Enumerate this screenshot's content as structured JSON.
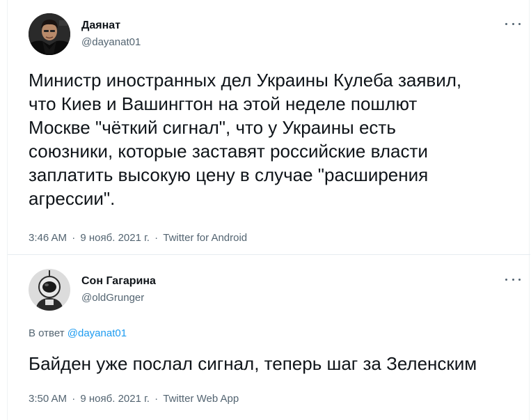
{
  "tweets": [
    {
      "display_name": "Даянат",
      "handle": "@dayanat01",
      "text": "Министр иностранных дел Украины Кулеба заявил,\nчто Киев и Вашингтон на этой неделе пошлют\nМоскве \"чёткий сигнал\", что у Украины есть\nсоюзники, которые заставят российские власти\nзаплатить высокую цену в случае \"расширения\nагрессии\".",
      "time": "3:46 AM",
      "date": "9 нояб. 2021 г.",
      "source": "Twitter for Android",
      "separator": "·",
      "avatar_icon": "man-portrait-avatar",
      "more_icon": "more-options-icon"
    },
    {
      "display_name": "Сон Гагарина",
      "handle": "@oldGrunger",
      "reply_prefix": "В ответ",
      "reply_mention": "@dayanat01",
      "text": "Байден уже послал сигнал, теперь шаг за Зеленским",
      "time": "3:50 AM",
      "date": "9 нояб. 2021 г.",
      "source": "Twitter Web App",
      "separator": "·",
      "avatar_icon": "astronaut-avatar",
      "more_icon": "more-options-icon"
    }
  ],
  "colors": {
    "text": "#0f1419",
    "secondary": "#536471",
    "accent": "#1d9bf0",
    "divider": "#e6ecf0"
  }
}
